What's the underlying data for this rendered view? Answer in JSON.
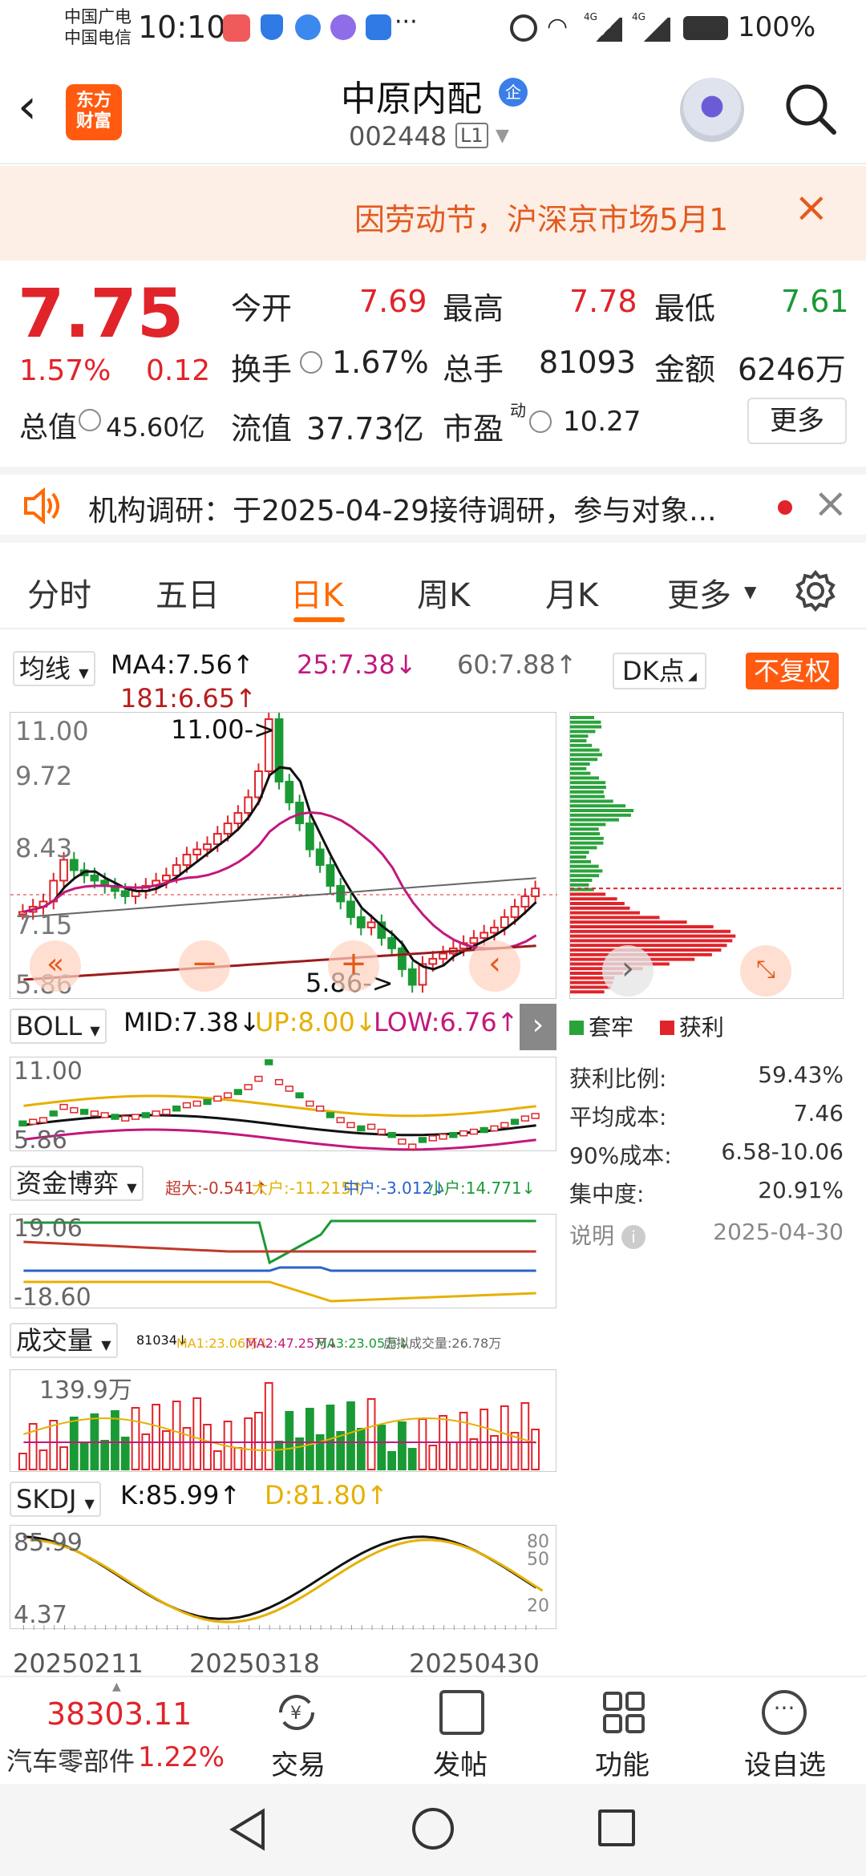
{
  "statusbar": {
    "carrier1": "中国广电",
    "carrier2": "中国电信",
    "time": "10:10",
    "battery": "100%",
    "net_badge1": "4G",
    "net_badge2": "4G"
  },
  "header": {
    "logo_line1": "东方",
    "logo_line2": "财富",
    "stock_name": "中原内配",
    "badge": "企",
    "stock_code": "002448",
    "level": "L1"
  },
  "notice": {
    "text": "因劳动节，沪深京市场5月1"
  },
  "quote": {
    "price": "7.75",
    "change_pct": "1.57%",
    "change_amt": "0.12",
    "open_label": "今开",
    "open": "7.69",
    "high_label": "最高",
    "high": "7.78",
    "low_label": "最低",
    "low": "7.61",
    "turnover_label": "换手",
    "turnover": "1.67%",
    "volume_label": "总手",
    "volume": "81093",
    "amount_label": "金额",
    "amount": "6246万",
    "mcap_label": "总值",
    "mcap": "45.60亿",
    "float_label": "流值",
    "float_cap": "37.73亿",
    "pe_label": "市盈",
    "pe_sup": "动",
    "pe": "10.27",
    "more": "更多"
  },
  "news": {
    "text": "机构调研：于2025-04-29接待调研，参与对象..."
  },
  "tabs": [
    "分时",
    "五日",
    "日K",
    "周K",
    "月K",
    "更多"
  ],
  "active_tab": "日K",
  "kline": {
    "ma_selector": "均线",
    "ma4": "MA4:7.56↑",
    "ma25": "25:7.38↓",
    "ma60": "60:7.88↑",
    "ma181": "181:6.65↑",
    "dk_btn": "DK点",
    "fq_btn": "不复权",
    "y_labels": [
      "11.00",
      "9.72",
      "8.43",
      "7.15",
      "5.86"
    ],
    "max_note": "11.00->",
    "min_note": "5.86->"
  },
  "boll": {
    "selector": "BOLL",
    "mid": "MID:7.38↓",
    "up": "UP:8.00↓",
    "low": "LOW:6.76↑",
    "y_top": "11.00",
    "y_bot": "5.86"
  },
  "fund": {
    "selector": "资金博弈",
    "super": "超大:-0.541↑",
    "big": "大户:-11.215↑",
    "mid": "中户:-3.012↓",
    "small": "小户:14.771↓",
    "y_top": "19.06",
    "y_bot": "-18.60"
  },
  "vol": {
    "selector": "成交量",
    "v": "81034↓",
    "ma1": "MA1:23.06万↓",
    "ma2": "MA2:47.25万↓",
    "ma3": "MA3:23.05万↓",
    "virtual": "虚拟成交量:26.78万",
    "y_top": "139.9万"
  },
  "skdj": {
    "selector": "SKDJ",
    "k": "K:85.99↑",
    "d": "D:81.80↑",
    "y_top": "85.99",
    "y_bot": "4.37",
    "lv80": "80",
    "lv50": "50",
    "lv20": "20"
  },
  "dates": [
    "20250211",
    "20250318",
    "20250430"
  ],
  "chips": {
    "legend_trap": "套牢",
    "legend_profit": "获利",
    "rows": [
      {
        "label": "获利比例:",
        "value": "59.43%"
      },
      {
        "label": "平均成本:",
        "value": "7.46"
      },
      {
        "label": "90%成本:",
        "value": "6.58-10.06"
      },
      {
        "label": "集中度:",
        "value": "20.91%"
      }
    ],
    "note_label": "说明",
    "date": "2025-04-30"
  },
  "bottom": {
    "index_value": "38303.11",
    "sector": "汽车零部件",
    "sector_pct": "1.22%",
    "trade": "交易",
    "post": "发帖",
    "func": "功能",
    "watch": "设自选"
  },
  "colors": {
    "up": "#e0242a",
    "down": "#1a9a35",
    "accent": "#ff6a00"
  }
}
